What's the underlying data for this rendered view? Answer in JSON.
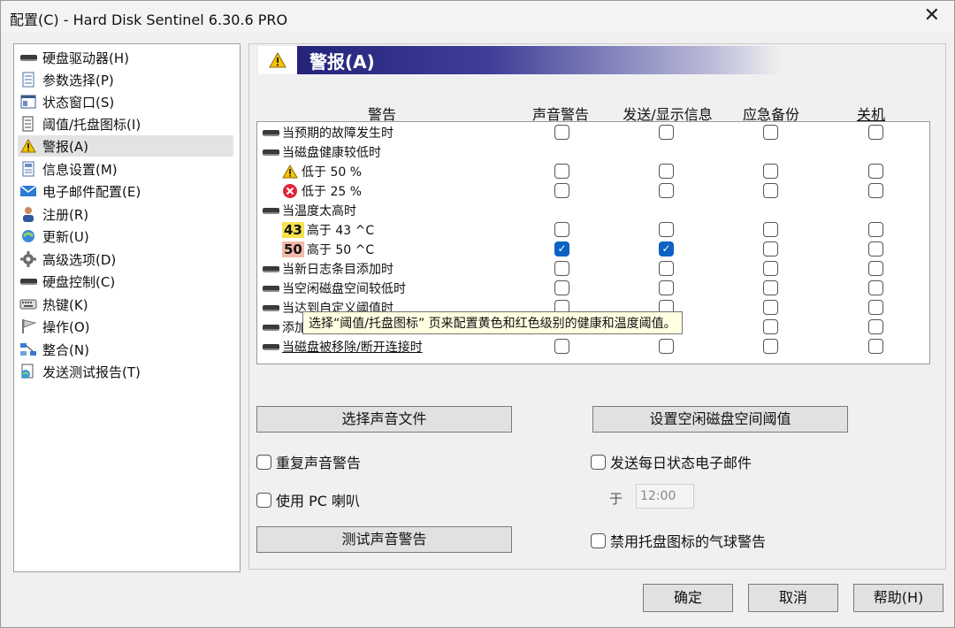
{
  "window": {
    "title": "配置(C)  -  Hard Disk Sentinel 6.30.6 PRO",
    "close": "✕"
  },
  "sidebar": {
    "items": [
      {
        "label": "硬盘驱动器(H)",
        "icon": "drive-icon"
      },
      {
        "label": "参数选择(P)",
        "icon": "preferences-icon"
      },
      {
        "label": "状态窗口(S)",
        "icon": "status-window-icon"
      },
      {
        "label": "阈值/托盘图标(I)",
        "icon": "threshold-icon"
      },
      {
        "label": "警报(A)",
        "icon": "warning-icon",
        "selected": true
      },
      {
        "label": "信息设置(M)",
        "icon": "info-settings-icon"
      },
      {
        "label": "电子邮件配置(E)",
        "icon": "email-icon"
      },
      {
        "label": "注册(R)",
        "icon": "register-icon"
      },
      {
        "label": "更新(U)",
        "icon": "update-icon"
      },
      {
        "label": "高级选项(D)",
        "icon": "advanced-icon"
      },
      {
        "label": "硬盘控制(C)",
        "icon": "disk-control-icon"
      },
      {
        "label": "热键(K)",
        "icon": "hotkey-icon"
      },
      {
        "label": "操作(O)",
        "icon": "actions-icon"
      },
      {
        "label": "整合(N)",
        "icon": "integration-icon"
      },
      {
        "label": "发送测试报告(T)",
        "icon": "send-report-icon"
      }
    ]
  },
  "header": {
    "title": "警报(A)"
  },
  "columns": {
    "alert": "警告",
    "sound": "声音警告",
    "message": "发送/显示信息",
    "backup": "应急备份",
    "shutdown": "关机"
  },
  "rows": [
    {
      "label": "当预期的故障发生时",
      "icon": "drive-icon",
      "checks": [
        false,
        false,
        false,
        false
      ]
    },
    {
      "label": "当磁盘健康较低时",
      "icon": "drive-icon",
      "checks": null
    },
    {
      "label": "低于 50 %",
      "icon": "warning-icon",
      "checks": [
        false,
        false,
        false,
        false
      ],
      "sub": true
    },
    {
      "label": "低于 25 %",
      "icon": "error-icon",
      "checks": [
        false,
        false,
        false,
        false
      ],
      "sub": true
    },
    {
      "label": "当温度太高时",
      "icon": "drive-icon",
      "checks": null
    },
    {
      "label": "高于 43 ^C",
      "badge": "43",
      "checks": [
        false,
        false,
        false,
        false
      ],
      "sub": true
    },
    {
      "label": "高于 50 ^C",
      "badge": "50",
      "checks": [
        true,
        true,
        false,
        false
      ],
      "sub": true
    },
    {
      "label": "当新日志条目添加时",
      "icon": "drive-icon",
      "checks": [
        false,
        false,
        false,
        false
      ]
    },
    {
      "label": "当空闲磁盘空间较低时",
      "icon": "drive-icon",
      "checks": [
        false,
        false,
        false,
        false
      ]
    },
    {
      "label": "当达到自定义阈值时",
      "icon": "drive-icon",
      "checks": [
        false,
        false,
        false,
        false
      ]
    },
    {
      "label": "添加",
      "icon": "drive-icon",
      "checks": [
        false,
        false,
        false,
        false
      ]
    },
    {
      "label": "当磁盘被移除/断开连接时",
      "icon": "drive-icon",
      "checks": [
        false,
        false,
        false,
        false
      ]
    }
  ],
  "tooltip": "选择“阈值/托盘图标” 页来配置黄色和红色级别的健康和温度阈值。",
  "buttons": {
    "select_sound": "选择声音文件",
    "set_free_space": "设置空闲磁盘空间阈值",
    "test_sound": "测试声音警告",
    "ok": "确定",
    "cancel": "取消",
    "help": "帮助(H)"
  },
  "options": {
    "repeat_sound": "重复声音警告",
    "use_pc_speaker": "使用 PC 喇叭",
    "send_daily_email": "发送每日状态电子邮件",
    "at_label": "于",
    "time": "12:00",
    "disable_balloon": "禁用托盘图标的气球警告"
  }
}
